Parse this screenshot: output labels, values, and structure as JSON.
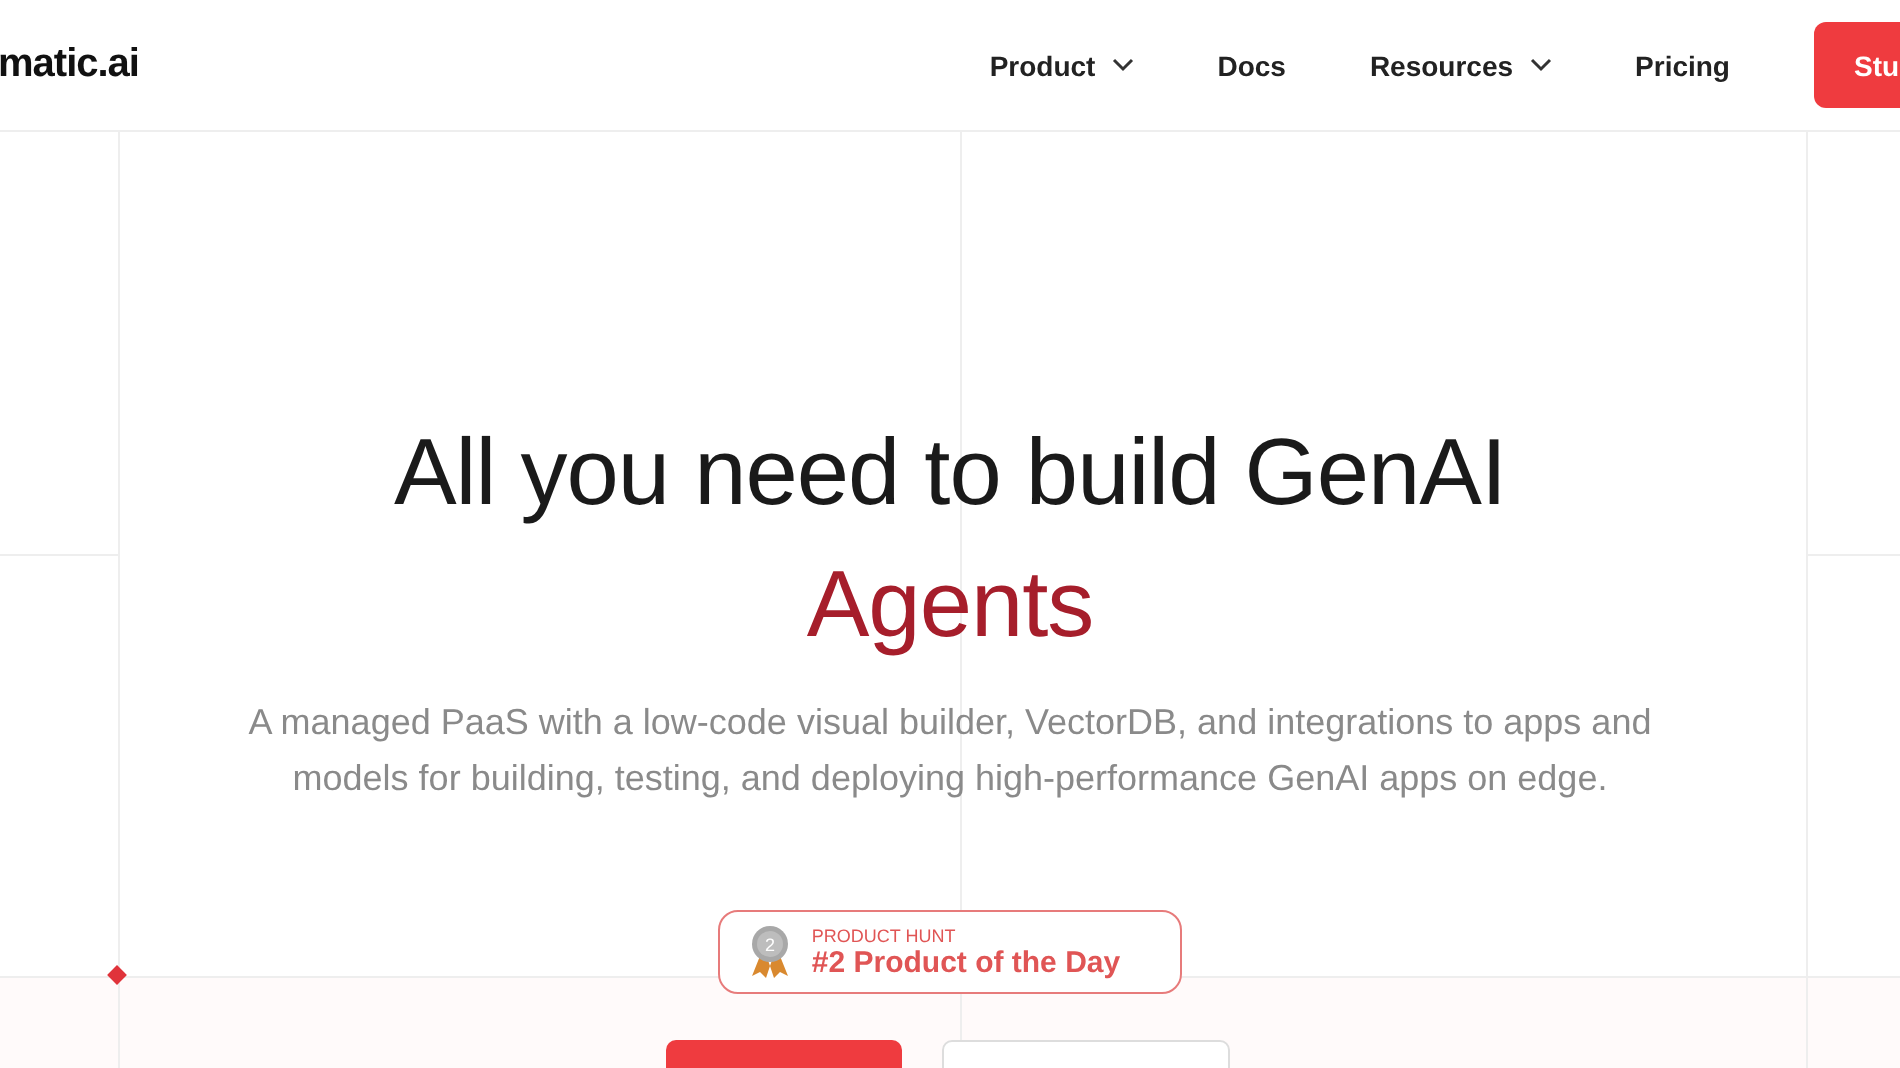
{
  "header": {
    "logo": "matic.ai",
    "nav": [
      {
        "label": "Product",
        "dropdown": true
      },
      {
        "label": "Docs",
        "dropdown": false
      },
      {
        "label": "Resources",
        "dropdown": true
      },
      {
        "label": "Pricing",
        "dropdown": false
      }
    ],
    "cta": "Stu"
  },
  "hero": {
    "title": "All you need to build GenAI",
    "highlight": "Agents",
    "subtitle": "A managed PaaS with a low-code visual builder, VectorDB, and integrations to apps and models for building, testing, and deploying high-performance GenAI apps on edge.",
    "badge": {
      "eyebrow": "PRODUCT HUNT",
      "text": "#2 Product of the Day",
      "rank": "2"
    }
  }
}
